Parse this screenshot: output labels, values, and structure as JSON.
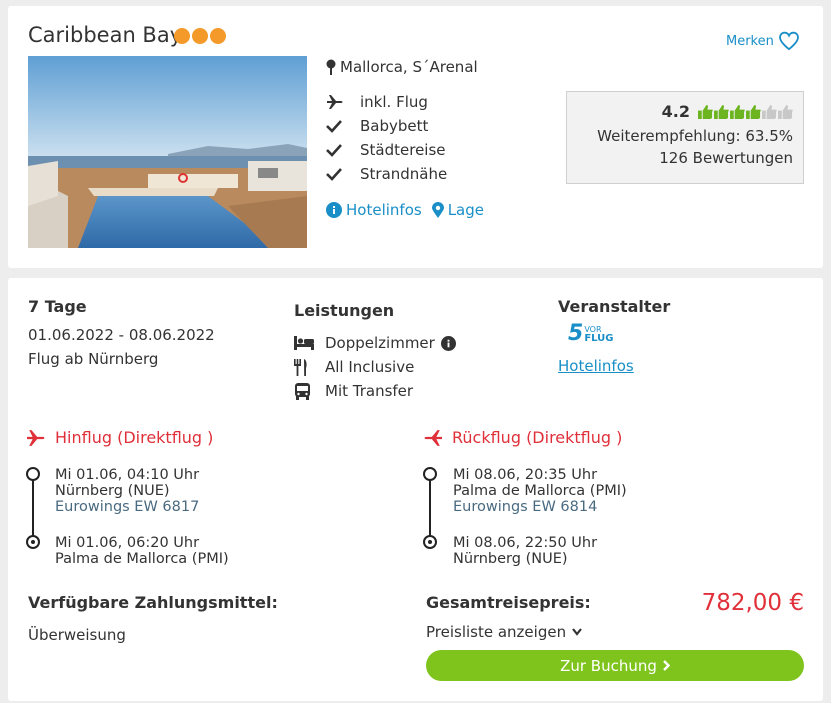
{
  "hotel": {
    "name": "Caribbean Bay",
    "stars": 3,
    "merken_label": "Merken",
    "location": "Mallorca, S´Arenal",
    "features": [
      {
        "icon": "plane-icon",
        "label": "inkl. Flug"
      },
      {
        "icon": "check-icon",
        "label": "Babybett"
      },
      {
        "icon": "check-icon",
        "label": "Städtereise"
      },
      {
        "icon": "check-icon",
        "label": "Strandnähe"
      }
    ],
    "links": {
      "hotelinfos": "Hotelinfos",
      "lage": "Lage"
    },
    "rating": {
      "score": "4.2",
      "thumbs_filled": 4,
      "thumbs_total": 6,
      "recommendation": "Weiterempfehlung: 63.5%",
      "reviews": "126 Bewertungen"
    }
  },
  "offer": {
    "duration": "7 Tage",
    "dates": "01.06.2022 - 08.06.2022",
    "departure": "Flug ab Nürnberg",
    "leistungen_title": "Leistungen",
    "leistungen": [
      {
        "icon": "bed-icon",
        "label": "Doppelzimmer"
      },
      {
        "icon": "cutlery-icon",
        "label": "All Inclusive"
      },
      {
        "icon": "bus-icon",
        "label": "Mit Transfer"
      }
    ],
    "veranstalter_title": "Veranstalter",
    "veranstalter_logo": {
      "number": "5",
      "top": "VOR",
      "bottom": "FLUG"
    },
    "veranstalter_link": "Hotelinfos"
  },
  "flights": {
    "outbound": {
      "title": "Hinflug (Direktflug )",
      "dep_time": "Mi 01.06, 04:10 Uhr",
      "dep_airport": "Nürnberg (NUE)",
      "airline": "Eurowings EW 6817",
      "arr_time": "Mi 01.06, 06:20 Uhr",
      "arr_airport": "Palma de Mallorca (PMI)"
    },
    "return": {
      "title": "Rückflug (Direktflug )",
      "dep_time": "Mi 08.06, 20:35 Uhr",
      "dep_airport": "Palma de Mallorca (PMI)",
      "airline": "Eurowings EW 6814",
      "arr_time": "Mi 08.06, 22:50 Uhr",
      "arr_airport": "Nürnberg (NUE)"
    }
  },
  "payment": {
    "title": "Verfügbare Zahlungsmittel:",
    "method": "Überweisung"
  },
  "total": {
    "label": "Gesamtreisepreis:",
    "price": "782,00 €",
    "price_list": "Preisliste anzeigen",
    "book_label": "Zur Buchung"
  },
  "colors": {
    "accent_red": "#e0303a",
    "link_blue": "#1a8fc7",
    "green": "#7fc41c",
    "star_orange": "#f39a2a"
  }
}
